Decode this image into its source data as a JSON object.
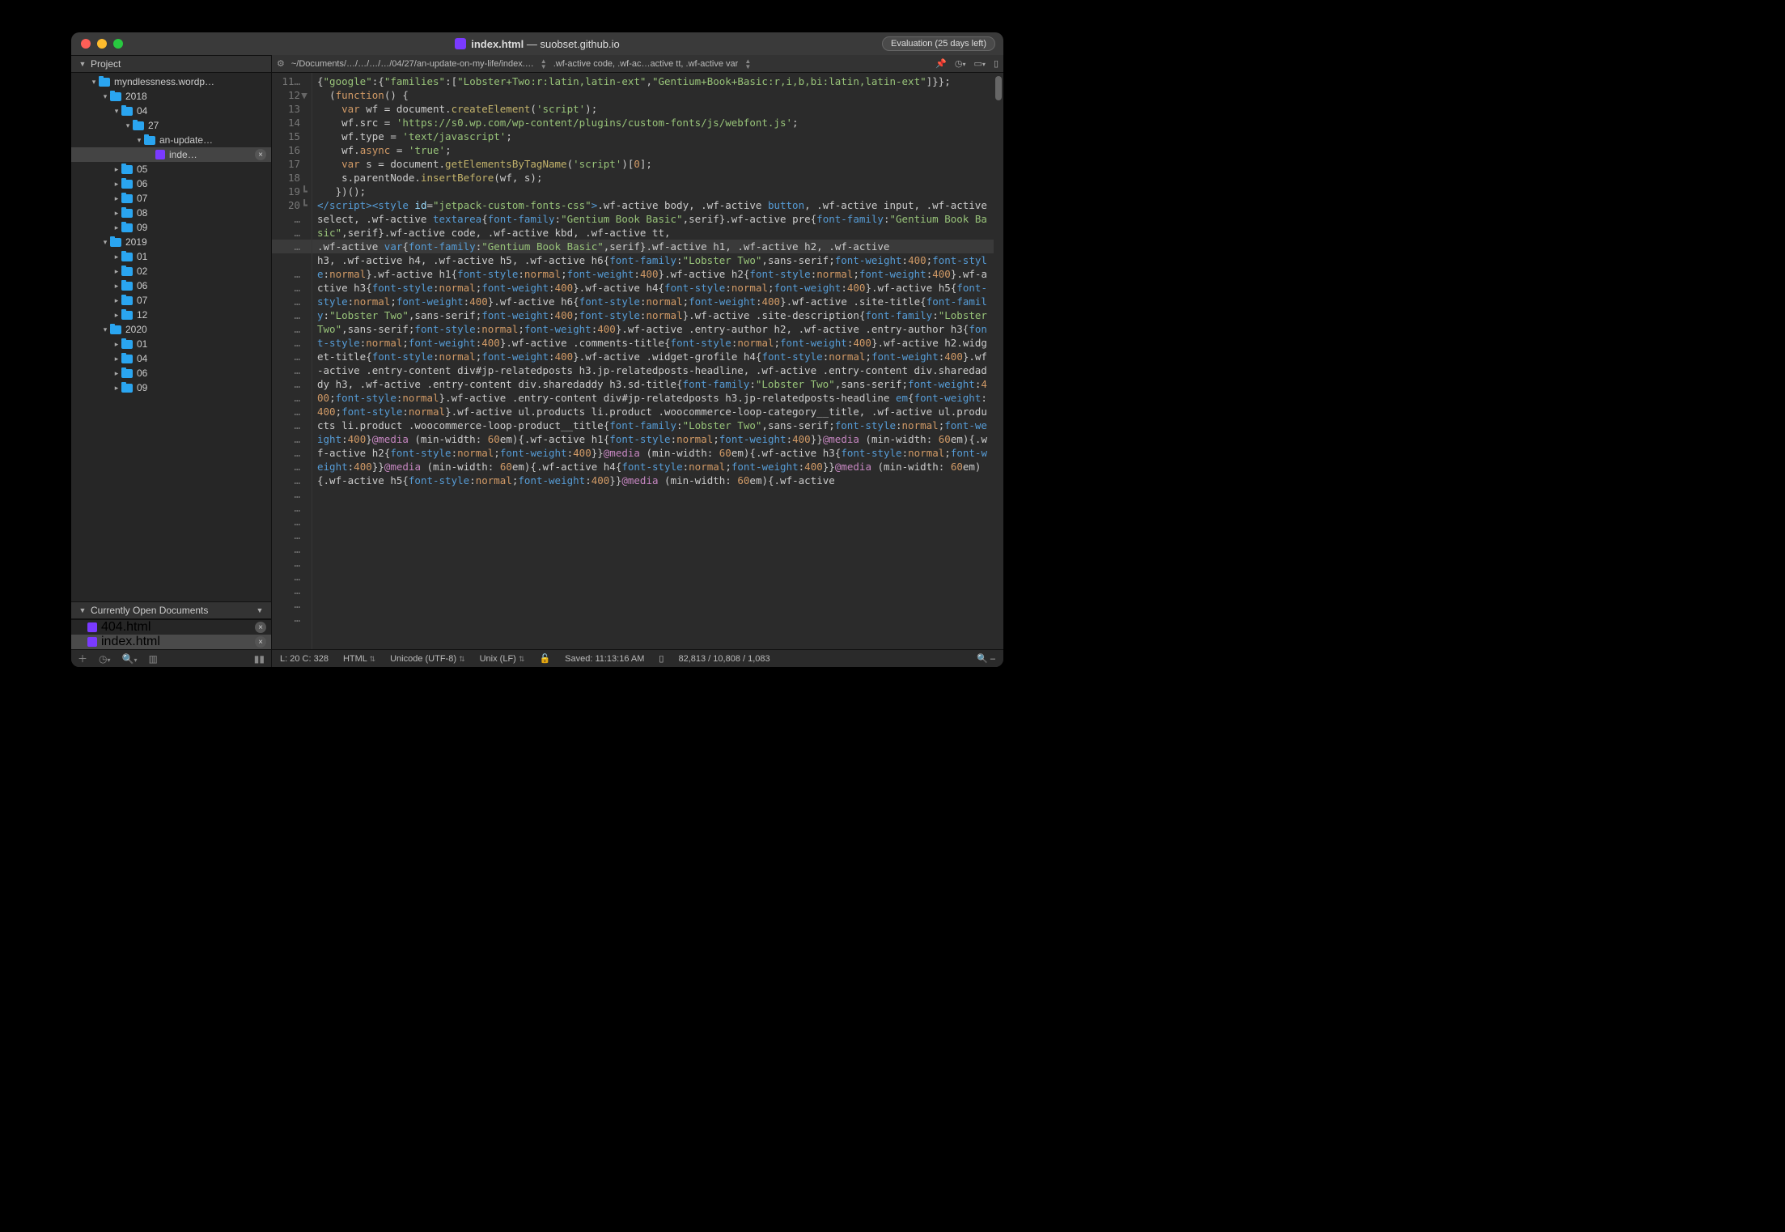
{
  "title": {
    "filename": "index.html",
    "project": "suobset.github.io"
  },
  "evaluation_badge": "Evaluation (25 days left)",
  "sidebar": {
    "project_label": "Project",
    "open_docs_label": "Currently Open Documents",
    "tree": [
      {
        "indent": 1,
        "disclosure": "down",
        "icon": "folder",
        "label": "myndlessness.wordp…"
      },
      {
        "indent": 2,
        "disclosure": "down",
        "icon": "folder",
        "label": "2018"
      },
      {
        "indent": 3,
        "disclosure": "down",
        "icon": "folder",
        "label": "04"
      },
      {
        "indent": 4,
        "disclosure": "down",
        "icon": "folder",
        "label": "27"
      },
      {
        "indent": 5,
        "disclosure": "down",
        "icon": "folder",
        "label": "an-update…"
      },
      {
        "indent": 6,
        "disclosure": "",
        "icon": "file",
        "label": "inde…",
        "active": true,
        "closeable": true
      },
      {
        "indent": 3,
        "disclosure": "right",
        "icon": "folder",
        "label": "05"
      },
      {
        "indent": 3,
        "disclosure": "right",
        "icon": "folder",
        "label": "06"
      },
      {
        "indent": 3,
        "disclosure": "right",
        "icon": "folder",
        "label": "07"
      },
      {
        "indent": 3,
        "disclosure": "right",
        "icon": "folder",
        "label": "08"
      },
      {
        "indent": 3,
        "disclosure": "right",
        "icon": "folder",
        "label": "09"
      },
      {
        "indent": 2,
        "disclosure": "down",
        "icon": "folder",
        "label": "2019"
      },
      {
        "indent": 3,
        "disclosure": "right",
        "icon": "folder",
        "label": "01"
      },
      {
        "indent": 3,
        "disclosure": "right",
        "icon": "folder",
        "label": "02"
      },
      {
        "indent": 3,
        "disclosure": "right",
        "icon": "folder",
        "label": "06"
      },
      {
        "indent": 3,
        "disclosure": "right",
        "icon": "folder",
        "label": "07"
      },
      {
        "indent": 3,
        "disclosure": "right",
        "icon": "folder",
        "label": "12"
      },
      {
        "indent": 2,
        "disclosure": "down",
        "icon": "folder",
        "label": "2020"
      },
      {
        "indent": 3,
        "disclosure": "right",
        "icon": "folder",
        "label": "01"
      },
      {
        "indent": 3,
        "disclosure": "right",
        "icon": "folder",
        "label": "04"
      },
      {
        "indent": 3,
        "disclosure": "right",
        "icon": "folder",
        "label": "06"
      },
      {
        "indent": 3,
        "disclosure": "right",
        "icon": "folder",
        "label": "09"
      }
    ],
    "open_docs": [
      {
        "icon": "file",
        "label": "404.html",
        "active": false,
        "closeable": true
      },
      {
        "icon": "file",
        "label": "index.html",
        "active": true,
        "closeable": true
      }
    ]
  },
  "pathbar": {
    "crumb": "~/Documents/…/…/…/…/04/27/an-update-on-my-life/index.…",
    "selector": ".wf-active code, .wf-ac…active tt, .wf-active var"
  },
  "gutter_lines": [
    "11…",
    "12",
    "13",
    "14",
    "15",
    "16",
    "17",
    "18",
    "19",
    "20",
    "…",
    "…",
    "…",
    "…",
    "…",
    "…",
    "…",
    "…",
    "…",
    "…",
    "…",
    "…",
    "…",
    "…",
    "…",
    "…",
    "…",
    "…",
    "…",
    "…",
    "…",
    "…",
    "…",
    "…",
    "…",
    "…",
    "…",
    "…",
    "…"
  ],
  "gutter_fold": {
    "1": "▼",
    "8": "┗",
    "9": "┗"
  },
  "highlight_line_index": 12,
  "statusbar": {
    "pos": "L: 20 C: 328",
    "lang": "HTML",
    "encoding": "Unicode (UTF-8)",
    "line_endings": "Unix (LF)",
    "saved": "Saved: 11:13:16 AM",
    "counts": "82,813 / 10,808 / 1,083"
  }
}
